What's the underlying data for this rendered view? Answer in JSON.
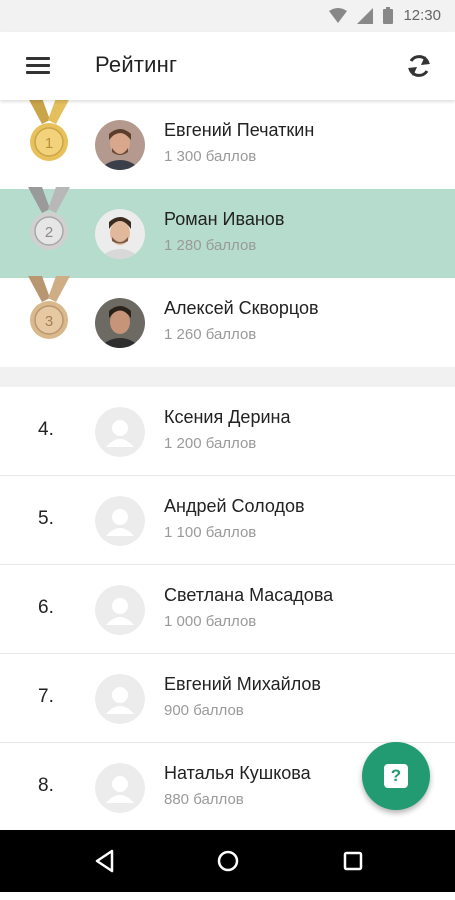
{
  "status_bar": {
    "time": "12:30"
  },
  "app_bar": {
    "title": "Рейтинг"
  },
  "leaderboard": {
    "top": [
      {
        "rank": "1",
        "name": "Евгений Печаткин",
        "points": "1 300 баллов",
        "medal": "gold"
      },
      {
        "rank": "2",
        "name": "Роман Иванов",
        "points": "1 280 баллов",
        "medal": "silver"
      },
      {
        "rank": "3",
        "name": "Алексей Скворцов",
        "points": "1 260 баллов",
        "medal": "bronze"
      }
    ],
    "rest": [
      {
        "rank": "4.",
        "name": "Ксения Дерина",
        "points": "1 200 баллов"
      },
      {
        "rank": "5.",
        "name": "Андрей Солодов",
        "points": "1 100 баллов"
      },
      {
        "rank": "6.",
        "name": "Светлана Масадова",
        "points": "1 000 баллов"
      },
      {
        "rank": "7.",
        "name": "Евгений Михайлов",
        "points": "900 баллов"
      },
      {
        "rank": "8.",
        "name": "Наталья Кушкова",
        "points": "880 баллов"
      }
    ]
  },
  "fab": {
    "label": "?"
  },
  "colors": {
    "highlight": "#b5dccd",
    "accent": "#239b72",
    "gold": "#e8c15b",
    "silver": "#d0d0d0",
    "bronze": "#d9b88c"
  }
}
